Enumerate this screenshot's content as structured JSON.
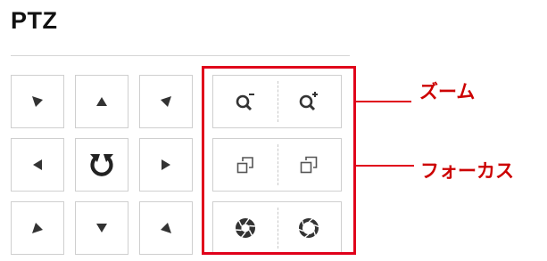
{
  "panel": {
    "title": "PTZ"
  },
  "icons": {
    "direction_pad": [
      "up-left-arrow-icon",
      "up-arrow-icon",
      "up-right-arrow-icon",
      "left-arrow-icon",
      "refresh-icon",
      "right-arrow-icon",
      "down-left-arrow-icon",
      "down-arrow-icon",
      "down-right-arrow-icon"
    ],
    "zoom": [
      "zoom-out-icon",
      "zoom-in-icon"
    ],
    "focus": [
      "focus-near-icon",
      "focus-far-icon"
    ],
    "iris": [
      "iris-open-icon",
      "iris-close-icon"
    ]
  },
  "annotations": {
    "zoom_label": "ズーム",
    "focus_label": "フォーカス"
  },
  "colors": {
    "icon": "#333333",
    "button_border": "#cfcfcf",
    "highlight": "#e0001b",
    "annotation_text": "#cc0000"
  }
}
